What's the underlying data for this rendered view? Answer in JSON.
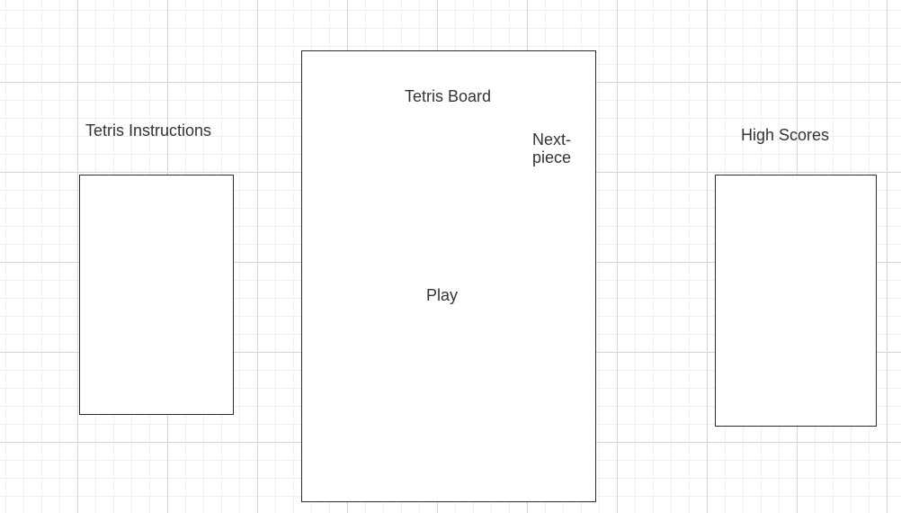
{
  "instructions": {
    "label": "Tetris Instructions"
  },
  "board": {
    "label": "Tetris Board",
    "next_piece_label": "Next-piece",
    "play_label": "Play"
  },
  "high_scores": {
    "label": "High Scores"
  },
  "colors": {
    "grid_major": "#d4d4d4",
    "grid_minor": "#efefef",
    "stroke": "#2b2b2b",
    "text": "#333333",
    "fill": "#ffffff"
  }
}
